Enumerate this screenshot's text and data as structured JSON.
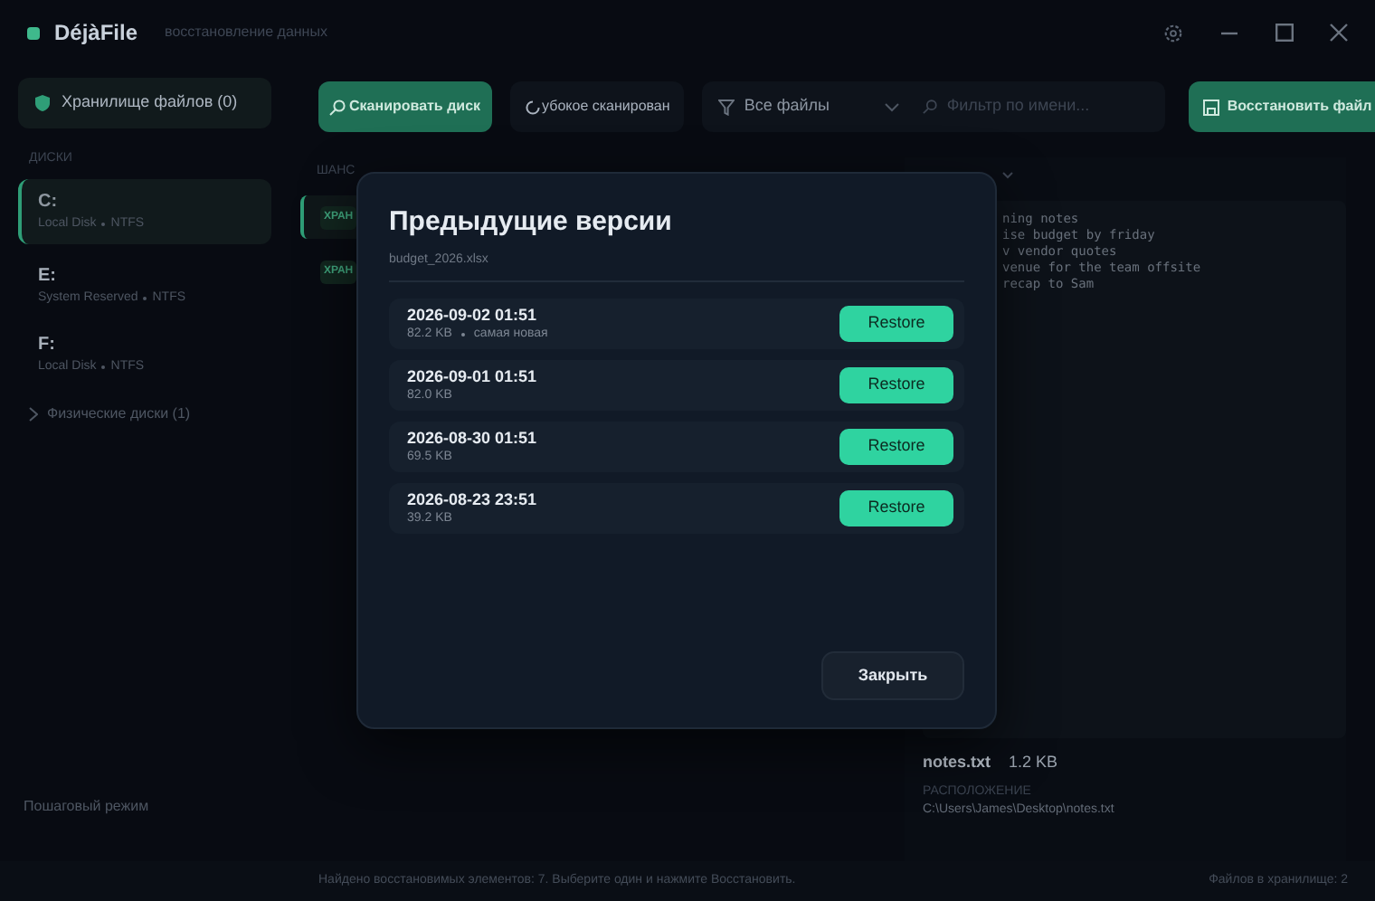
{
  "window": {
    "app_name": "DéjàFile",
    "subtitle": "восстановление данных"
  },
  "sidebar": {
    "vault_button": "Хранилище файлов (0)",
    "section_label": "ДИСКИ",
    "drives": [
      {
        "letter": "C:",
        "label": "Local Disk",
        "fs": "NTFS",
        "selected": true
      },
      {
        "letter": "E:",
        "label": "System Reserved",
        "fs": "NTFS",
        "selected": false
      },
      {
        "letter": "F:",
        "label": "Local Disk",
        "fs": "NTFS",
        "selected": false
      }
    ],
    "physical_disks": {
      "label": "Физические диски (1)",
      "expanded": false
    },
    "footer": "Пошаговый режим"
  },
  "toolbar": {
    "scan_button": "Сканировать диск",
    "deep_scan_button": "убокое сканирован",
    "file_type": "Все файлы",
    "filter_placeholder": "Фильтр по имени...",
    "restore_button": "Восстановить файл"
  },
  "table": {
    "columns": [
      "ШАНС"
    ],
    "rows": [
      {
        "chip": "ХРАН",
        "selected": true
      },
      {
        "chip": "ХРАН",
        "selected": false
      }
    ]
  },
  "preview": {
    "lines": [
      "ning notes",
      "ise budget by friday",
      "v vendor quotes",
      "venue for the team offsite",
      "recap to Sam"
    ],
    "file_name": "notes.txt",
    "file_size": "1.2 KB",
    "location_label": "РАСПОЛОЖЕНИЕ",
    "location": "C:\\Users\\James\\Desktop\\notes.txt"
  },
  "dialog": {
    "title": "Предыдущие версии",
    "file": "budget_2026.xlsx",
    "versions": [
      {
        "date": "2026-09-02 01:51",
        "size": "82.2 KB",
        "note": "самая новая",
        "button": "Restore"
      },
      {
        "date": "2026-09-01 01:51",
        "size": "82.0 KB",
        "button": "Restore"
      },
      {
        "date": "2026-08-30 01:51",
        "size": "69.5 KB",
        "button": "Restore"
      },
      {
        "date": "2026-08-23 23:51",
        "size": "39.2 KB",
        "button": "Restore"
      }
    ],
    "close_button": "Закрыть"
  },
  "status_bar": {
    "left": "Найдено восстановимых элементов: 7. Выберите один и нажмите Восстановить.",
    "right": "Файлов в хранилище: 2"
  }
}
